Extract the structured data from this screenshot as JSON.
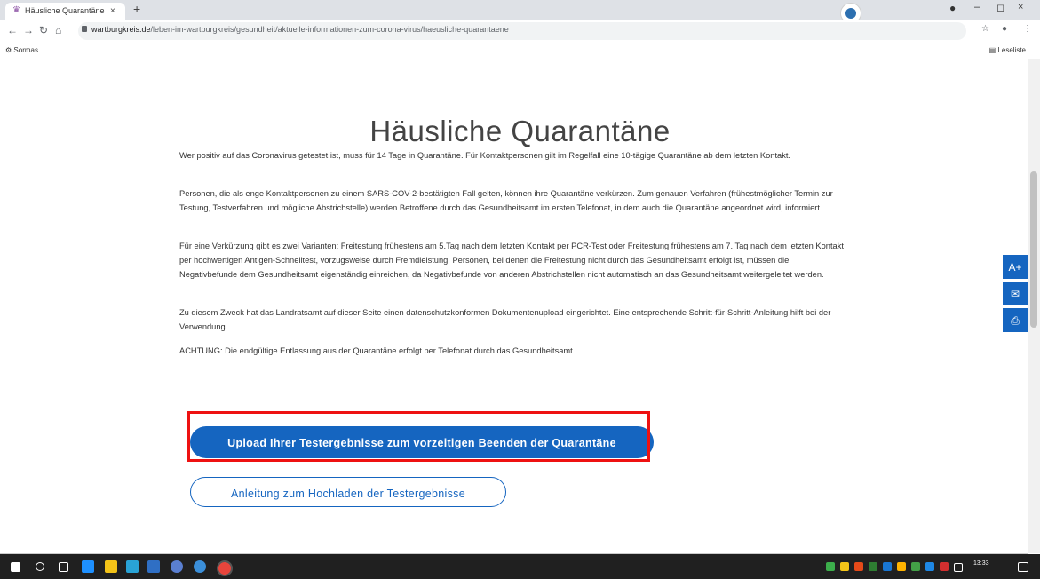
{
  "browser": {
    "tab_title": "Häusliche Quarantäne » Wartbur",
    "tab_close": "×",
    "new_tab": "+",
    "url_domain": "wartburgkreis.de",
    "url_path": "/leben-im-wartburgkreis/gesundheit/aktuelle-informationen-zum-corona-virus/haeusliche-quarantaene",
    "bookmark_item": "Sormas",
    "reading_list": "Leseliste",
    "win_min": "–",
    "win_restore": "◻",
    "win_close": "×"
  },
  "page": {
    "heading": "Häusliche Quarantäne",
    "paragraphs": [
      "Wer positiv auf das Coronavirus getestet ist, muss für 14 Tage in Quarantäne. Für Kontaktpersonen gilt im Regelfall eine 10-tägige Quarantäne ab dem letzten Kontakt.",
      "Personen, die als enge Kontaktpersonen zu einem SARS-COV-2-bestätigten Fall gelten, können ihre Quarantäne verkürzen. Zum genauen Verfahren (frühestmöglicher Termin zur Testung, Testverfahren und mögliche Abstrichstelle) werden Betroffene durch das Gesundheitsamt im ersten Telefonat, in dem auch die Quarantäne angeordnet wird, informiert.",
      "Für eine Verkürzung gibt es zwei Varianten: Freitestung frühestens am 5.Tag nach dem letzten Kontakt per PCR-Test oder Freitestung frühestens am 7. Tag nach dem letzten Kontakt per hochwertigen Antigen-Schnelltest, vorzugsweise durch Fremdleistung. Personen, bei denen die Freitestung nicht durch das Gesundheitsamt erfolgt ist, müssen die Negativbefunde dem Gesundheitsamt eigenständig einreichen, da Negativbefunde von anderen Abstrichstellen nicht automatisch an das Gesundheitsamt weitergeleitet werden.",
      "Zu diesem Zweck hat das Landratsamt auf dieser Seite einen datenschutzkonformen Dokumentenupload  eingerichtet. Eine entsprechende Schritt-für-Schritt-Anleitung hilft bei der Verwendung.",
      "ACHTUNG: Die endgültige Entlassung aus der Quarantäne erfolgt per Telefonat durch das Gesundheitsamt."
    ],
    "upload_button": "Upload Ihrer Testergebnisse zum vorzeitigen Beenden der Quarantäne",
    "guide_button": "Anleitung zum Hochladen der Testergebnisse"
  },
  "tools": {
    "font_size": "A+",
    "mail_icon": "✉",
    "print_icon": "⎙"
  },
  "taskbar": {
    "clock_time": "13:33"
  },
  "colors": {
    "accent": "#1565c0",
    "highlight": "#ee1111"
  }
}
